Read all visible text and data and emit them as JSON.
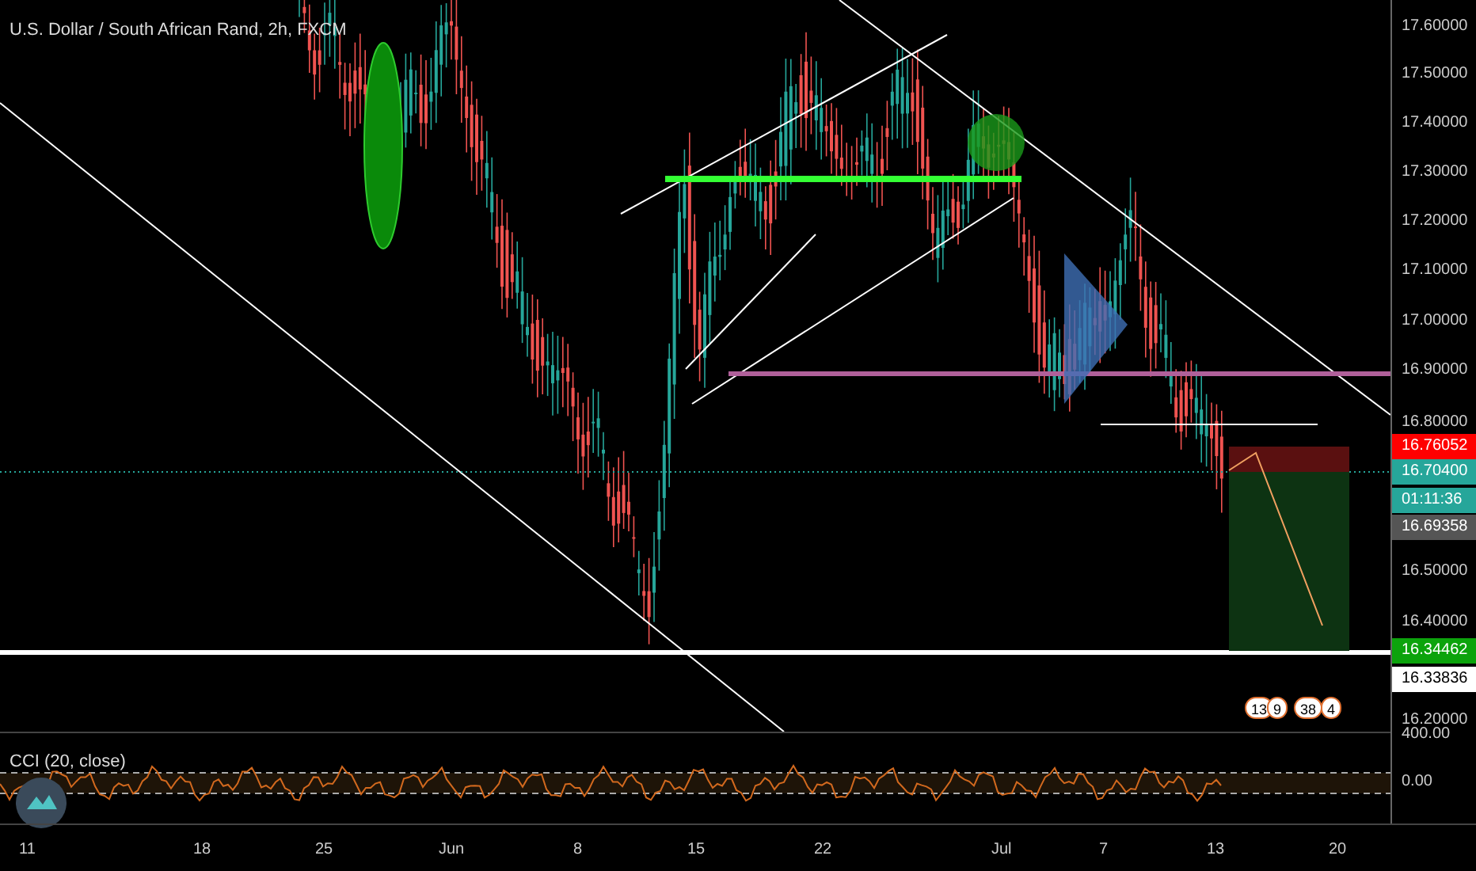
{
  "title": "U.S. Dollar / South African Rand, 2h, FXCM",
  "price_axis": [
    "17.60000",
    "17.50000",
    "17.40000",
    "17.30000",
    "17.20000",
    "17.10000",
    "17.00000",
    "16.90000",
    "16.80000",
    "16.50000",
    "16.40000",
    "16.20000"
  ],
  "price_badges": [
    {
      "label": "16.76052",
      "color": "#ff0000"
    },
    {
      "label": "16.70400",
      "color": "#26a69a"
    },
    {
      "label": "01:11:36",
      "color": "#26a69a"
    },
    {
      "label": "16.69358",
      "color": "#555555"
    },
    {
      "label": "16.34462",
      "color": "#0ca30c"
    },
    {
      "label": "16.33836",
      "color": "#ffffff"
    }
  ],
  "event_markers": [
    "13",
    "9",
    "38",
    "4"
  ],
  "indicator": {
    "label": "CCI (20, close)",
    "axis": [
      "400.00",
      "0.00"
    ]
  },
  "time_axis": [
    "11",
    "18",
    "25",
    "Jun",
    "8",
    "15",
    "22",
    "Jul",
    "7",
    "13",
    "20"
  ]
}
